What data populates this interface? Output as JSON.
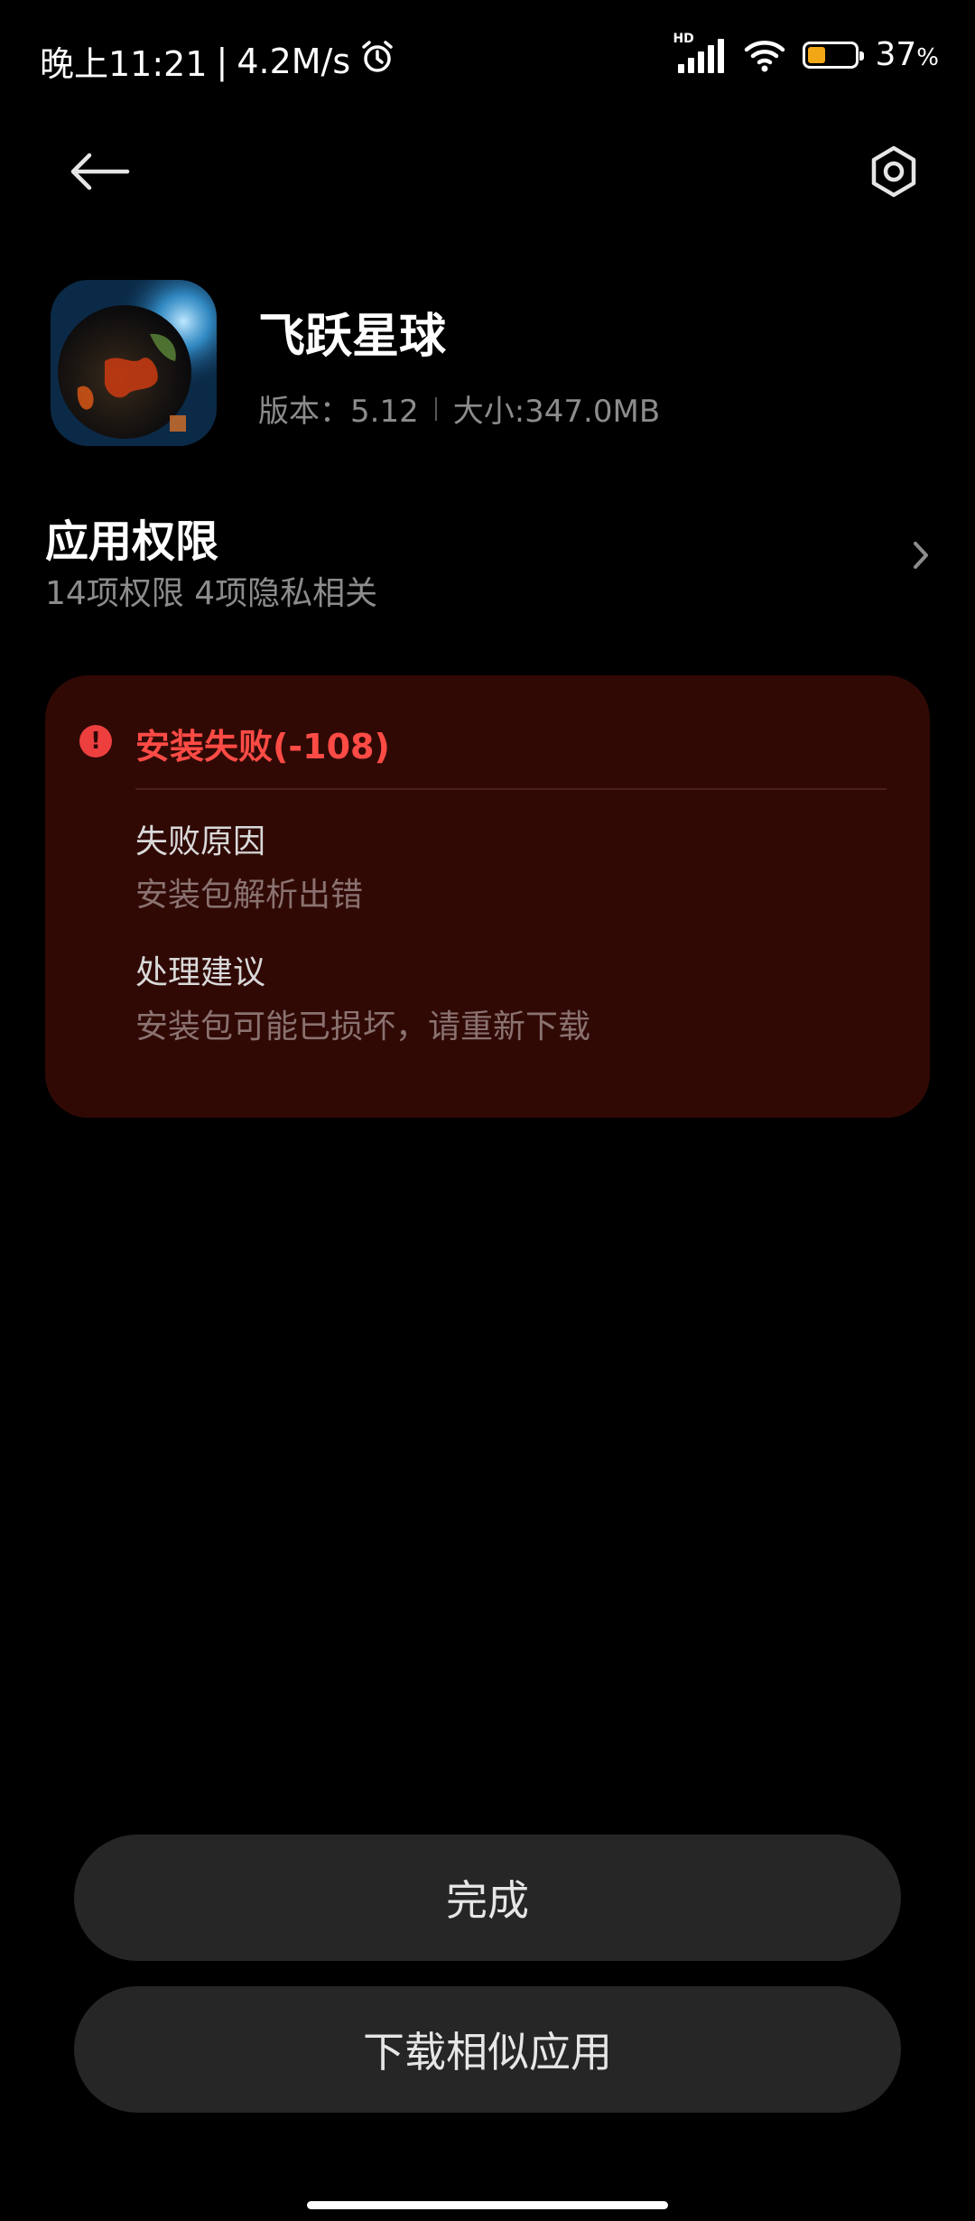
{
  "status_bar": {
    "time": "晚上11:21",
    "separator": "|",
    "speed": "4.2M/s",
    "network_badge": "HD",
    "battery_level": 37,
    "battery_text": "37",
    "battery_unit": "%",
    "battery_color": "#f2a716"
  },
  "top_bar": {
    "back_icon": "arrow-left-icon",
    "settings_icon": "hexagon-settings-icon"
  },
  "app": {
    "name": "飞跃星球",
    "version": "版本：5.12",
    "size": "大小:347.0MB"
  },
  "permissions": {
    "title": "应用权限",
    "summary": "14项权限 4项隐私相关"
  },
  "error": {
    "title": "安装失败(-108)",
    "reason_label": "失败原因",
    "reason_value": "安装包解析出错",
    "advice_label": "处理建议",
    "advice_value": "安装包可能已损坏，请重新下载",
    "accent_color": "#ff4b45",
    "card_color": "#300905"
  },
  "buttons": {
    "done": "完成",
    "download_similar": "下载相似应用"
  }
}
